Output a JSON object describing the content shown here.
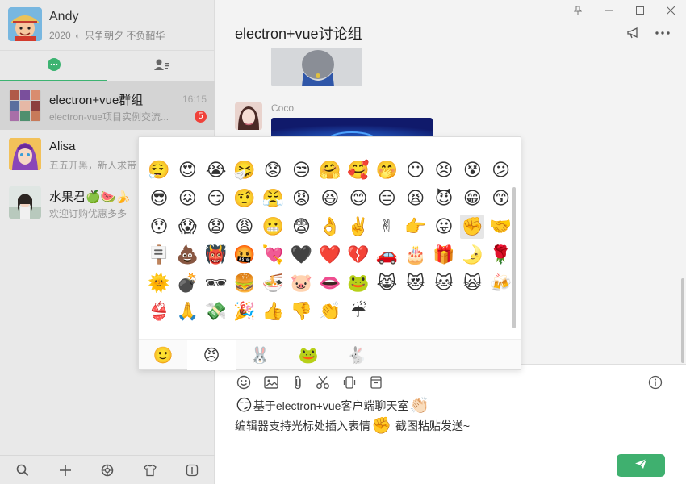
{
  "user": {
    "name": "Andy",
    "year": "2020",
    "motto": "只争朝夕 不负韶华"
  },
  "chats": [
    {
      "name": "electron+vue群组",
      "time": "16:15",
      "preview": "electron-vue项目实例交流...",
      "badge": "5"
    },
    {
      "name": "Alisa",
      "time": "",
      "preview": "五五开黑，新人求带"
    },
    {
      "name": "水果君🍏🍉🍌",
      "time": "",
      "preview": "欢迎订购优惠多多"
    }
  ],
  "conversation": {
    "title": "electron+vue讨论组",
    "sender": "Coco"
  },
  "editor": {
    "line1": "基于electron+vue客户端聊天室",
    "line2_a": "编辑器支持光标处插入表情",
    "line2_b": "截图粘贴发送~"
  },
  "emoji_grid": [
    [
      "😮‍💨",
      "😍",
      "😭",
      "🤧",
      "😟",
      "😒",
      "🤗",
      "🥰",
      "🤭",
      "😶",
      "😣",
      "😵",
      "😕"
    ],
    [
      "😎",
      "😖",
      "😏",
      "🤨",
      "😤",
      "😡",
      "😆",
      "😊",
      "😑",
      "😫",
      "😈",
      "😁",
      "😙"
    ],
    [
      "😯",
      "😱",
      "😧",
      "😩",
      "😬",
      "😨",
      "👌",
      "✌️",
      "✌",
      "👉",
      "😛",
      "✊",
      "🤝"
    ],
    [
      "🪧",
      "💩",
      "👹",
      "🤬",
      "💘",
      "🖤",
      "❤️",
      "💔",
      "🚗",
      "🎂",
      "🎁",
      "🌛",
      "🌹"
    ],
    [
      "🌞",
      "💣",
      "🕶",
      "🍔",
      "🍜",
      "🐷",
      "👄",
      "🐸",
      "😹",
      "😻",
      "🐱",
      "🙀",
      "🍻"
    ],
    [
      "👙",
      "🙏",
      "💸",
      "🎉",
      "👍",
      "👎",
      "👏",
      "☔"
    ]
  ],
  "picker_tabs": [
    "🙂",
    "😠",
    "🐰",
    "🐸",
    "🐇"
  ],
  "colors": {
    "accent": "#3fb06f",
    "badge": "#f0423a",
    "sidebar": "#e9e9e9"
  }
}
